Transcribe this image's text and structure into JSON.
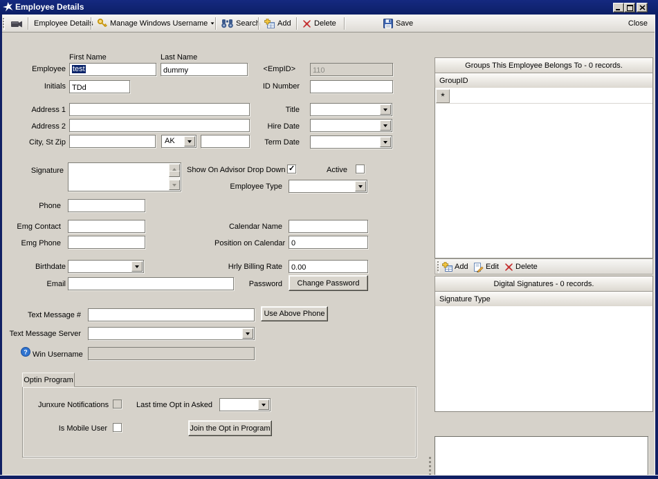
{
  "window": {
    "title": "Employee Details"
  },
  "toolbar": {
    "employee_details": "Employee Details",
    "manage_windows_username": "Manage Windows Username",
    "search": "Search",
    "add": "Add",
    "delete": "Delete",
    "save": "Save",
    "close": "Close"
  },
  "form": {
    "headers": {
      "first_name": "First Name",
      "last_name": "Last Name"
    },
    "fields": {
      "employee": {
        "label": "Employee",
        "first_name": "test",
        "last_name": "dummy"
      },
      "empid": {
        "label": "<EmpID>",
        "value": "110"
      },
      "initials": {
        "label": "Initials",
        "value": "TDd"
      },
      "id_number": {
        "label": "ID Number",
        "value": ""
      },
      "address1": {
        "label": "Address 1",
        "value": ""
      },
      "address2": {
        "label": "Address 2",
        "value": ""
      },
      "city_st_zip": {
        "label": "City, St Zip",
        "city": "",
        "state": "AK",
        "zip": ""
      },
      "title": {
        "label": "Title",
        "value": ""
      },
      "hire_date": {
        "label": "Hire Date",
        "value": ""
      },
      "term_date": {
        "label": "Term Date",
        "value": ""
      },
      "signature": {
        "label": "Signature",
        "value": ""
      },
      "show_on_advisor": {
        "label": "Show On Advisor Drop Down",
        "checked": true
      },
      "active": {
        "label": "Active",
        "checked": false
      },
      "employee_type": {
        "label": "Employee Type",
        "value": ""
      },
      "phone": {
        "label": "Phone",
        "value": ""
      },
      "emg_contact": {
        "label": "Emg Contact",
        "value": ""
      },
      "emg_phone": {
        "label": "Emg Phone",
        "value": ""
      },
      "calendar_name": {
        "label": "Calendar Name",
        "value": ""
      },
      "position_on_calendar": {
        "label": "Position on Calendar",
        "value": "0"
      },
      "birthdate": {
        "label": "Birthdate",
        "value": ""
      },
      "hrly_billing_rate": {
        "label": "Hrly Billing Rate",
        "value": "0.00"
      },
      "email": {
        "label": "Email",
        "value": ""
      },
      "password": {
        "label": "Password",
        "button": "Change Password"
      },
      "text_message_number": {
        "label": "Text Message #",
        "value": "",
        "button": "Use Above Phone"
      },
      "text_message_server": {
        "label": "Text Message Server",
        "value": ""
      },
      "win_username": {
        "label": "Win Username",
        "value": ""
      }
    }
  },
  "optin": {
    "tab": "Optin Program",
    "junxure_notifications": {
      "label": "Junxure Notifications",
      "checked": false
    },
    "last_time_opt_in_asked": {
      "label": "Last time Opt in Asked",
      "value": ""
    },
    "is_mobile_user": {
      "label": "Is Mobile User",
      "checked": false
    },
    "join_button": "Join the Opt in Program"
  },
  "groups_panel": {
    "header": "Groups This Employee Belongs To - 0 records.",
    "column": "GroupID",
    "new_row_marker": "*",
    "toolbar": {
      "add": "Add",
      "edit": "Edit",
      "delete": "Delete"
    }
  },
  "signatures_panel": {
    "header": "Digital Signatures - 0 records.",
    "column": "Signature Type"
  }
}
